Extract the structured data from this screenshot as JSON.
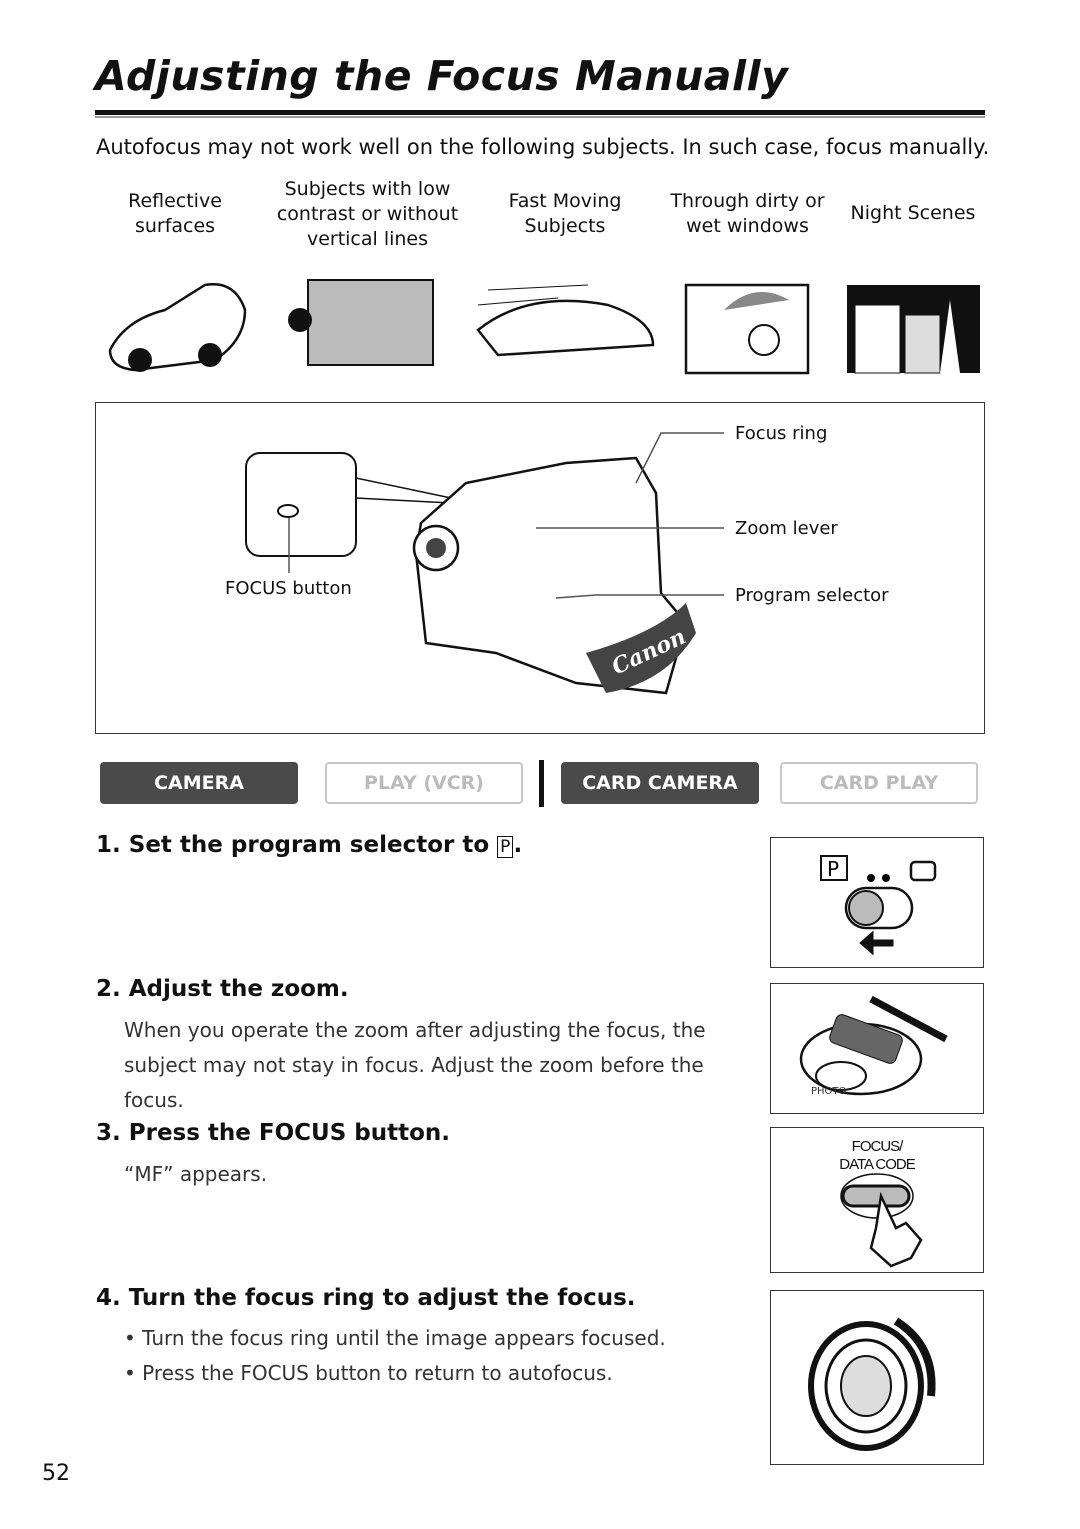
{
  "title": "Adjusting the Focus Manually",
  "intro": "Autofocus may not work well on the following subjects. In such case, focus manually.",
  "subjects": [
    "Reflective surfaces",
    "Subjects with low contrast or without vertical lines",
    "Fast Moving Subjects",
    "Through dirty or wet windows",
    "Night Scenes"
  ],
  "diagram": {
    "focus_ring": "Focus ring",
    "zoom_lever": "Zoom lever",
    "program_selector": "Program selector",
    "focus_button": "FOCUS button",
    "brand_logo": "Canon",
    "button_label": "FOCUS/ DATA CODE"
  },
  "modes": [
    {
      "label": "CAMERA",
      "active": true
    },
    {
      "label": "PLAY (VCR)",
      "active": false
    },
    {
      "label": "CARD CAMERA",
      "active": true
    },
    {
      "label": "CARD PLAY",
      "active": false
    }
  ],
  "steps": [
    {
      "title": "1. Set the program selector to",
      "symbol": "P",
      "end": "."
    },
    {
      "title": "2. Adjust the zoom.",
      "body": "When you operate the zoom after adjusting the focus, the subject may not stay in focus. Adjust the zoom before the focus."
    },
    {
      "title": "3. Press the FOCUS button.",
      "body": "“MF” appears."
    },
    {
      "title": "4. Turn the focus ring to adjust the focus.",
      "bullets": [
        "• Turn the focus ring until the image appears focused.",
        "• Press the FOCUS button to return to autofocus."
      ]
    }
  ],
  "illus": {
    "focus_label_1": "FOCUS/",
    "focus_label_2": "DATA CODE",
    "photo": "PHOTO"
  },
  "page_number": "52"
}
